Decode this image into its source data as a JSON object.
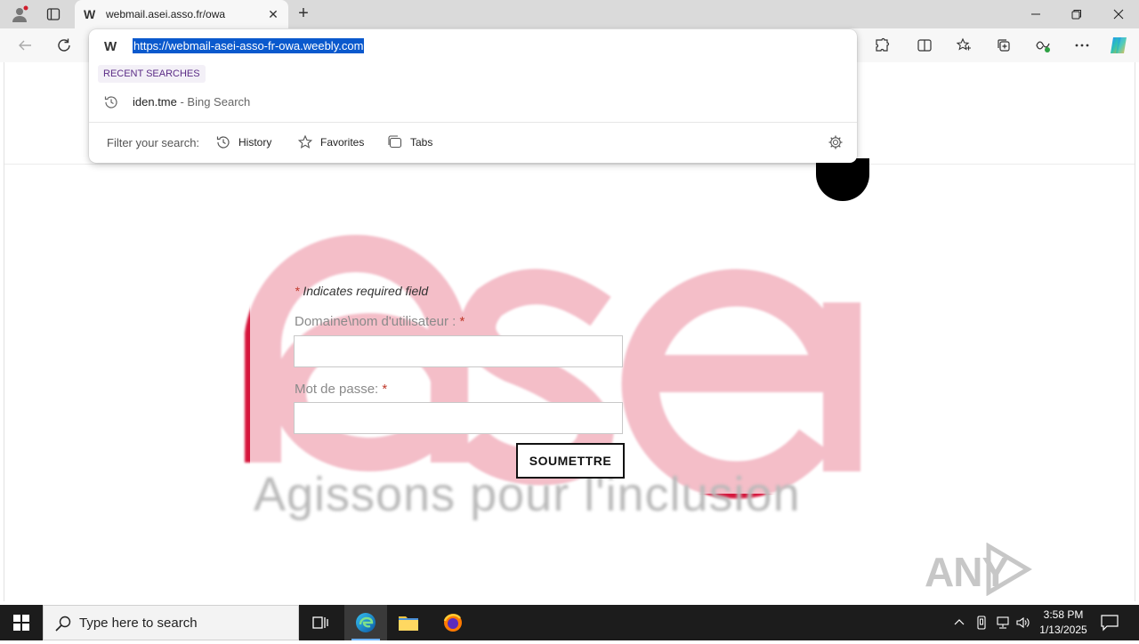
{
  "browser": {
    "tab_title": "webmail.asei.asso.fr/owa",
    "tab_close": "✕",
    "new_tab": "+",
    "address_url": "https://webmail-asei-asso-fr-owa.weebly.com"
  },
  "omnibox": {
    "recent_label": "RECENT SEARCHES",
    "recent_query": "iden.tme",
    "recent_suffix": " - Bing Search",
    "filter_label": "Filter your search:",
    "filters": [
      "History",
      "Favorites",
      "Tabs"
    ]
  },
  "page": {
    "tagline": "Agissons pour l'inclusion",
    "required_star": "*",
    "required_note": " Indicates required field",
    "username_label": "Domaine\\nom d'utilisateur : ",
    "password_label": "Mot de passe: ",
    "submit_label": "SOUMETTRE",
    "watermark": "ANY RUN"
  },
  "taskbar": {
    "search_placeholder": "Type here to search",
    "time": "3:58 PM",
    "date": "1/13/2025"
  },
  "colors": {
    "logo_red": "#d6163c",
    "selection": "#0a59cd",
    "required": "#c0392b"
  }
}
